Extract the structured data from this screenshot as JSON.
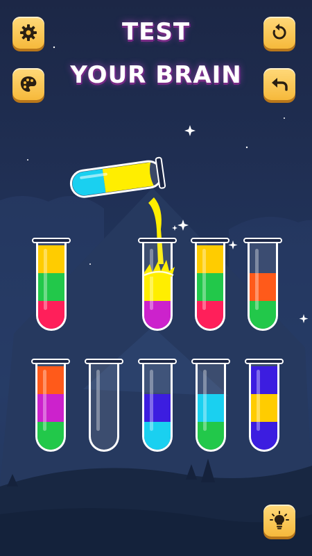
{
  "title": {
    "line1": "TEST",
    "line2": "YOUR BRAIN"
  },
  "buttons": {
    "settings": {
      "icon": "gear-icon"
    },
    "palette": {
      "icon": "palette-icon"
    },
    "restart": {
      "icon": "restart-icon"
    },
    "undo": {
      "icon": "undo-icon"
    },
    "hint": {
      "icon": "lightbulb-icon"
    }
  },
  "colors": {
    "yellow": "#ffcc00",
    "green": "#22c84a",
    "red": "#ff1f5a",
    "magenta": "#cc22cc",
    "orange": "#ff5a1a",
    "blue": "#3c1de0",
    "cyan": "#1ad0f0",
    "bright_yellow": "#ffee00",
    "button": "#f6b93b",
    "background": "#203055"
  },
  "pouring_tube": {
    "contents": [
      "cyan",
      "bright_yellow"
    ]
  },
  "tubes_row1": [
    {
      "layers": [
        "red",
        "green",
        "yellow"
      ]
    },
    {
      "layers": [
        "magenta",
        "bright_yellow"
      ],
      "receiving_pour": true
    },
    {
      "layers": [
        "red",
        "green",
        "yellow"
      ]
    },
    {
      "layers": [
        "green",
        "orange"
      ]
    }
  ],
  "tubes_row2": [
    {
      "layers": [
        "green",
        "magenta",
        "orange"
      ]
    },
    {
      "layers": []
    },
    {
      "layers": [
        "cyan",
        "blue"
      ]
    },
    {
      "layers": [
        "green",
        "cyan"
      ]
    },
    {
      "layers": [
        "blue",
        "yellow",
        "blue"
      ]
    }
  ]
}
